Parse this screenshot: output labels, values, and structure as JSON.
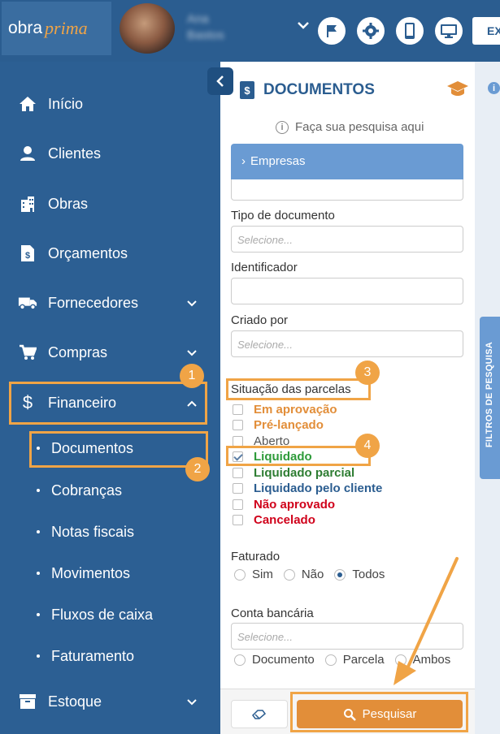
{
  "header": {
    "logo_part1": "obra",
    "logo_part2": "prima",
    "user_name_line1": "Ana",
    "user_name_line2": "Bastos",
    "exit_label": "EX",
    "icons": [
      "flag-icon",
      "gear-icon",
      "mobile-icon",
      "monitor-icon"
    ]
  },
  "sidebar": {
    "items": [
      {
        "label": "Início",
        "icon": "home-icon"
      },
      {
        "label": "Clientes",
        "icon": "person-icon"
      },
      {
        "label": "Obras",
        "icon": "buildings-icon"
      },
      {
        "label": "Orçamentos",
        "icon": "dollar-document-icon"
      },
      {
        "label": "Fornecedores",
        "icon": "truck-icon"
      },
      {
        "label": "Compras",
        "icon": "cart-icon"
      },
      {
        "label": "Financeiro",
        "icon": "dollar-icon"
      },
      {
        "label": "Estoque",
        "icon": "archive-icon"
      }
    ],
    "sub_items": [
      "Documentos",
      "Cobranças",
      "Notas fiscais",
      "Movimentos",
      "Fluxos de caixa",
      "Faturamento"
    ]
  },
  "annotations": {
    "badges": [
      "1",
      "2",
      "3",
      "4"
    ]
  },
  "panel": {
    "title": "DOCUMENTOS",
    "hint": "Faça sua pesquisa aqui",
    "accordion_label": "Empresas",
    "fields": {
      "tipo_label": "Tipo de documento",
      "tipo_placeholder": "Selecione...",
      "identificador_label": "Identificador",
      "criado_label": "Criado por",
      "criado_placeholder": "Selecione...",
      "situacao_label": "Situação das parcelas",
      "faturado_label": "Faturado",
      "conta_label": "Conta bancária",
      "conta_placeholder": "Selecione..."
    },
    "situacao_options": [
      {
        "label": "Em aprovação",
        "color": "#e28e39",
        "checked": false
      },
      {
        "label": "Pré-lançado",
        "color": "#e28e39",
        "checked": false
      },
      {
        "label": "Aberto",
        "color": "#555555",
        "checked": false
      },
      {
        "label": "Liquidado",
        "color": "#2e9b3a",
        "checked": true
      },
      {
        "label": "Liquidado parcial",
        "color": "#2e7d32",
        "checked": false
      },
      {
        "label": "Liquidado pelo cliente",
        "color": "#2b5d90",
        "checked": false
      },
      {
        "label": "Não aprovado",
        "color": "#d0021b",
        "checked": false
      },
      {
        "label": "Cancelado",
        "color": "#d0021b",
        "checked": false
      }
    ],
    "faturado_options": [
      "Sim",
      "Não",
      "Todos"
    ],
    "faturado_selected": "Todos",
    "conta_options": [
      "Documento",
      "Parcela",
      "Ambos"
    ],
    "search_label": "Pesquisar",
    "filters_tab_label": "FILTROS DE PESQUISA"
  },
  "colors": {
    "brand_blue": "#2b5d90",
    "accent_orange": "#f0a446",
    "accordion_blue": "#6a9bd3"
  }
}
